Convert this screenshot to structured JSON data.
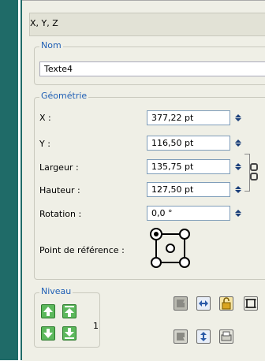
{
  "panel": {
    "title": "X, Y, Z"
  },
  "nom": {
    "legend": "Nom",
    "value": "Texte4"
  },
  "geometrie": {
    "legend": "Géométrie",
    "fields": [
      {
        "label": "X :",
        "value": "377,22 pt"
      },
      {
        "label": "Y :",
        "value": "116,50 pt"
      },
      {
        "label": "Largeur :",
        "value": "135,75 pt"
      },
      {
        "label": "Hauteur :",
        "value": "127,50 pt"
      },
      {
        "label": "Rotation :",
        "value": "0,0 °"
      }
    ],
    "reference_label": "Point de référence :"
  },
  "niveau": {
    "legend": "Niveau",
    "count": "1"
  },
  "icons": {
    "up_arrow": "arrow-up-icon",
    "top_arrow": "arrow-top-icon",
    "down_arrow": "arrow-down-icon",
    "bottom_arrow": "arrow-bottom-icon",
    "lock": "lock-icon"
  },
  "colors": {
    "accent": "#1f5fb5",
    "sidebar": "#1f6b68",
    "panel_bg": "#efefe6",
    "level_button": "#5cb85c"
  }
}
